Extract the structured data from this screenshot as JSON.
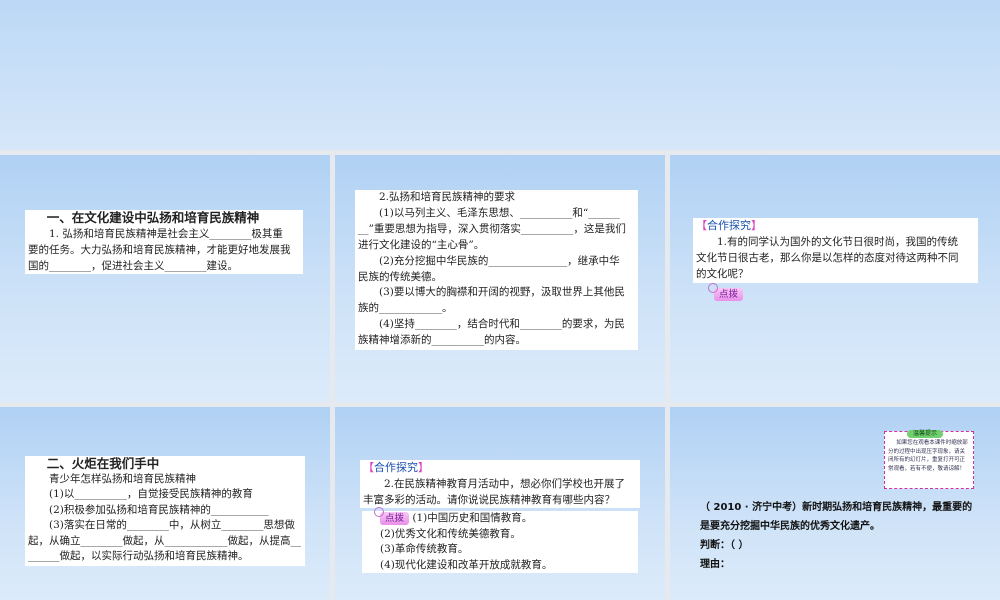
{
  "slide1": {
    "heading": "一、在文化建设中弘扬和培育民族精神",
    "lines": [
      "1. 弘扬和培育民族精神是社会主义________极其重",
      "要的任务。大力弘扬和培育民族精神，才能更好地发展我",
      "国的________，促进社会主义________建设。"
    ]
  },
  "slide2": {
    "lines": [
      "2.弘扬和培育民族精神的要求",
      "(1)以马列主义、毛泽东思想、__________和“______",
      "__”重要思想为指导，深入贯彻落实__________，这是我们",
      "进行文化建设的“主心骨”。",
      "(2)充分挖掘中华民族的_______________，继承中华",
      "民族的传统美德。",
      "(3)要以博大的胸襟和开阔的视野，汲取世界上其他民",
      "族的____________。",
      "(4)坚持________，结合时代和________的要求，为民",
      "族精神增添新的__________的内容。"
    ]
  },
  "slide3": {
    "tag": "合作探究",
    "lines": [
      "1.有的同学认为国外的文化节日很时尚，我国的传统",
      "文化节日很古老，那么你是以怎样的态度对待这两种不同",
      "的文化呢？"
    ],
    "hint": "点拨"
  },
  "slide4": {
    "heading": "二、火炬在我们手中",
    "lines": [
      "青少年怎样弘扬和培育民族精神",
      "(1)以__________，自觉接受民族精神的教育",
      "(2)积极参加弘扬和培育民族精神的___________",
      "(3)落实在日常的________中，从树立________思想做",
      "起，从确立________做起，从____________做起，从提高__",
      "______做起，以实际行动弘扬和培育民族精神。"
    ]
  },
  "slide5": {
    "tag": "合作探究",
    "lines": [
      "2.在民族精神教育月活动中，想必你们学校也开展了",
      "丰富多彩的活动。请你说说民族精神教育有哪些内容？"
    ],
    "hint": "点拨",
    "answers": [
      "(1)中国历史和国情教育。",
      "(2)优秀文化和传统美德教育。",
      "(3)革命传统教育。",
      "(4)现代化建设和改革开放成就教育。"
    ]
  },
  "slide6": {
    "note_title": "温馨提示",
    "note_text": "如果您在观看本课件时缩放部分的过程中出现压字现象，请关闭所有的幻灯片，重复打开可正常观看，若有不便，敬请谅解！",
    "lines": [
      "（ 2010 · 济宁中考）新时期弘扬和培育民族精神，最重要的",
      "是要充分挖掘中华民族的优秀文化遗产。",
      "判断：（        ）",
      "理由："
    ]
  }
}
